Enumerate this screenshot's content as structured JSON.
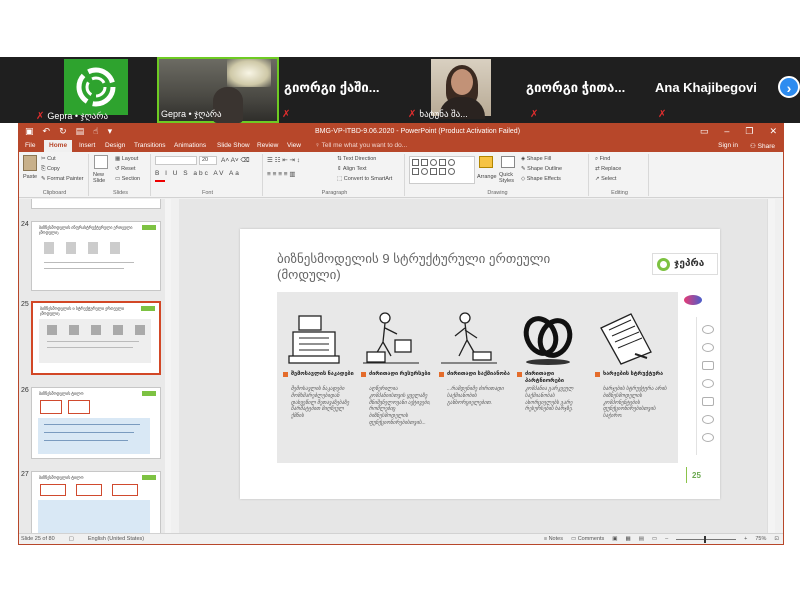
{
  "participants": [
    {
      "name": "Gepra • ჯღარა"
    },
    {
      "name": "Gepra • ჯღარა"
    },
    {
      "name": "გიორგი ქაში..."
    },
    {
      "name": "ხატუნა შა..."
    },
    {
      "name": "გიორგი ჭითა..."
    },
    {
      "name": "Ana Khajibegovi"
    }
  ],
  "window": {
    "title": "BMG-VP-ITBD-9.06.2020 - PowerPoint (Product Activation Failed)",
    "tabs": [
      "File",
      "Home",
      "Insert",
      "Design",
      "Transitions",
      "Animations",
      "Slide Show",
      "Review",
      "View"
    ],
    "active_tab": "Home",
    "tell_me": "Tell me what you want to do...",
    "sign_in": "Sign in",
    "share": "Share"
  },
  "ribbon": {
    "clipboard": {
      "paste": "Paste",
      "cut": "Cut",
      "copy": "Copy",
      "format_painter": "Format Painter",
      "label": "Clipboard"
    },
    "slides": {
      "new_slide": "New Slide",
      "layout": "Layout",
      "reset": "Reset",
      "section": "Section",
      "label": "Slides"
    },
    "font": {
      "size": "20",
      "label": "Font"
    },
    "paragraph": {
      "text_direction": "Text Direction",
      "align_text": "Align Text",
      "convert": "Convert to SmartArt",
      "label": "Paragraph"
    },
    "drawing": {
      "arrange": "Arrange",
      "quick_styles": "Quick Styles",
      "shape_fill": "Shape Fill",
      "shape_outline": "Shape Outline",
      "shape_effects": "Shape Effects",
      "label": "Drawing"
    },
    "editing": {
      "find": "Find",
      "replace": "Replace",
      "select": "Select",
      "label": "Editing"
    }
  },
  "thumbnails": [
    {
      "num": "24",
      "title": "ბიზნესმოდელის ინფრასტრუქტურული ერთეული (მოდული)"
    },
    {
      "num": "25",
      "title": "ბიზნესმოდელის 9 სტრუქტურული ერთეული (მოდული)"
    },
    {
      "num": "26",
      "title": "ბიზნესმოდელის ტილო"
    },
    {
      "num": "27",
      "title": "ბიზნესმოდელის ტილო"
    }
  ],
  "slide": {
    "title": "ბიზნესმოდელის 9 სტრუქტურული ერთეული (მოდული)",
    "brand": "ჯეპრა",
    "page_number": "25",
    "components": [
      {
        "heading": "შემოსავლის ნაკადები",
        "text": "შემოსავლის ნაკადები მომხმარებლებიდან დახვეწილ შეთავაზებაზე წარმატებით მიღწეულ ქმნის"
      },
      {
        "heading": "ძირითადი რესურსები",
        "text": "აღწერილია კომპანიისთვის ყველაზე მნიშვნელოვანი აქტივები, რომლებიც ბიზნესმოდელის ფუნქციონირებისთვის..."
      },
      {
        "heading": "ძირითადი საქმიანობა",
        "text": "...რამდენიმე ძირითადი საქმიანობის განხორციელებით."
      },
      {
        "heading": "ძირითადი პარტნიორები",
        "text": "კომპანია გარკვეულ საქმიანობას ახორციელებს გარე რესურსების ხარჯზე."
      },
      {
        "heading": "ხარჯების სტრუქტურა",
        "text": "ხარჯების სტრუქტურა არის ბიზნესმოდელის კომპონენტების ფუნქციონირებისთვის საჭირო."
      }
    ]
  },
  "statusbar": {
    "slide_of": "Slide 25 of 80",
    "language": "English (United States)",
    "notes": "Notes",
    "comments": "Comments",
    "zoom": "75%"
  }
}
